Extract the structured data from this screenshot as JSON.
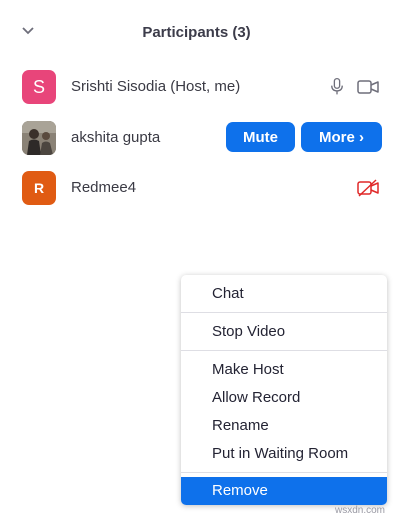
{
  "header": {
    "title": "Participants (3)",
    "collapse_icon": "chevron-down-icon"
  },
  "participants": [
    {
      "initial": "S",
      "name": "Srishti Sisodia (Host, me)",
      "avatar_color": "#e8457a",
      "mic": "microphone-icon",
      "video": "video-camera-icon"
    },
    {
      "initial": "",
      "name": "akshita gupta",
      "avatar": "photo",
      "mute_label": "Mute",
      "more_label": "More ›"
    },
    {
      "initial": "R",
      "name": "Redmee4",
      "avatar_color": "#e05b13",
      "video": "video-off-icon"
    }
  ],
  "context_menu": {
    "items": [
      "Chat",
      "Stop Video",
      "Make Host",
      "Allow Record",
      "Rename",
      "Put in Waiting Room",
      "Remove"
    ],
    "active": "Remove"
  },
  "colors": {
    "accent": "#0e71eb",
    "video_off": "#e02828"
  },
  "watermark": "wsxdn.com"
}
